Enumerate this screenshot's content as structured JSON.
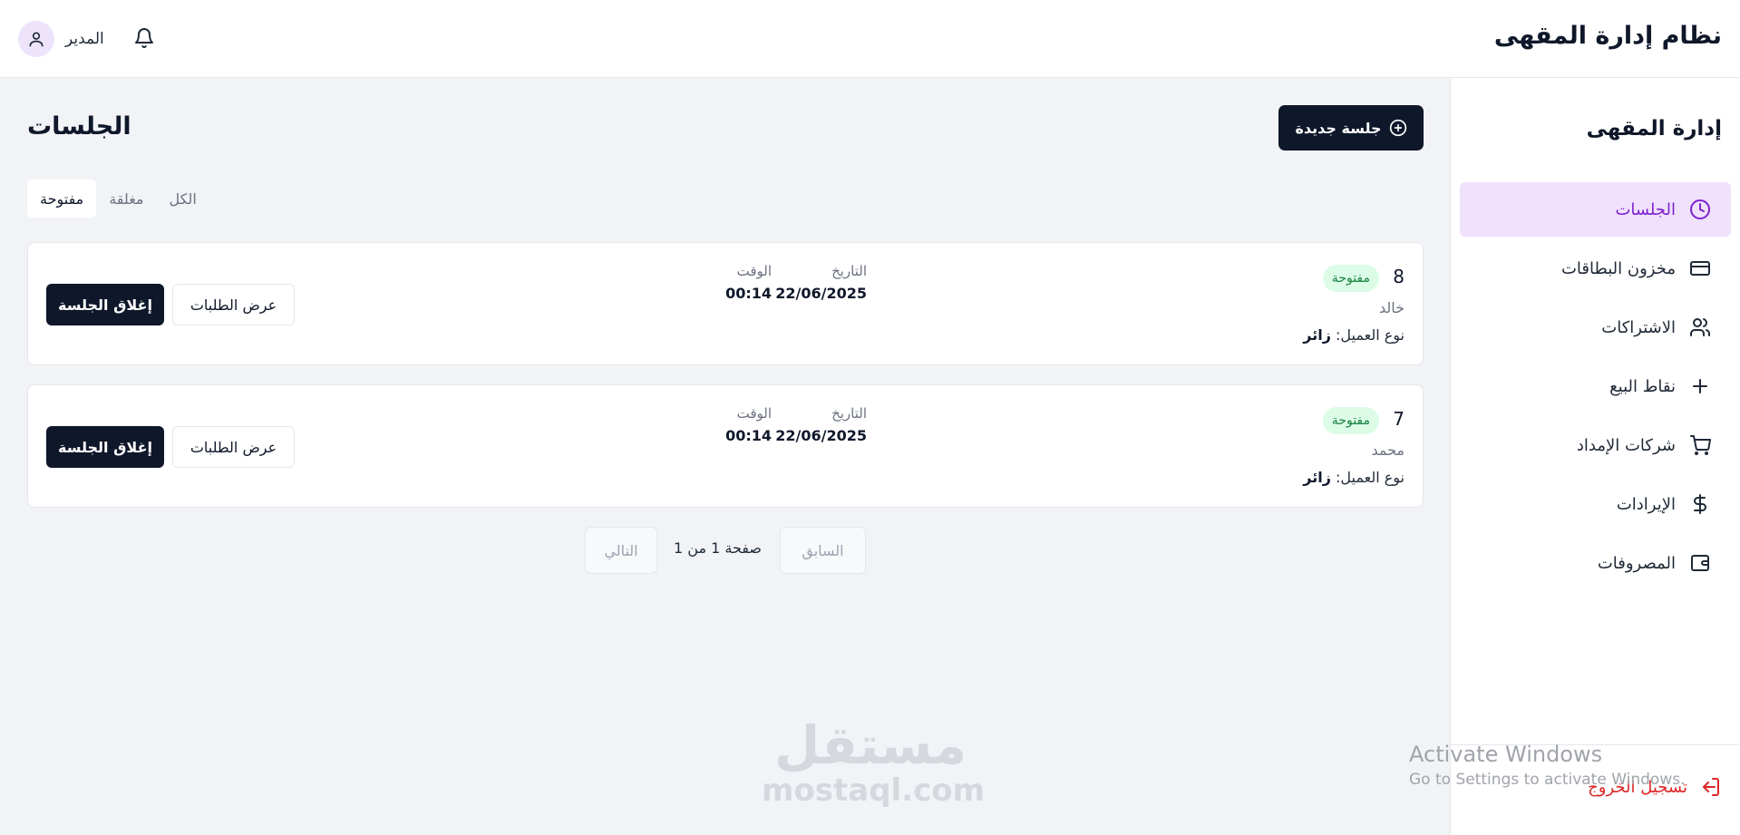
{
  "header": {
    "app_title": "نظام إدارة المقهى",
    "user_name": "المدير",
    "avatar_icon": "user-icon",
    "notification_icon": "bell-icon"
  },
  "sidebar": {
    "title": "إدارة المقهى",
    "items": [
      {
        "label": "الجلسات",
        "icon": "clock-icon",
        "active": true
      },
      {
        "label": "مخزون البطاقات",
        "icon": "card-icon",
        "active": false
      },
      {
        "label": "الاشتراكات",
        "icon": "users-icon",
        "active": false
      },
      {
        "label": "نقاط البيع",
        "icon": "plus-icon",
        "active": false
      },
      {
        "label": "شركات الإمداد",
        "icon": "cart-icon",
        "active": false
      },
      {
        "label": "الإيرادات",
        "icon": "dollar-icon",
        "active": false
      },
      {
        "label": "المصروفات",
        "icon": "wallet-icon",
        "active": false
      }
    ],
    "logout_label": "تسجيل الخروج"
  },
  "main": {
    "page_title": "الجلسات",
    "new_session_label": "جلسة جديدة",
    "tabs": [
      {
        "label": "مفتوحة",
        "active": true
      },
      {
        "label": "مغلقة",
        "active": false
      },
      {
        "label": "الكل",
        "active": false
      }
    ],
    "date_label": "التاريخ",
    "time_label": "الوقت",
    "client_type_label": "نوع العميل:",
    "view_orders_label": "عرض الطلبات",
    "close_session_label": "إغلاق الجلسة",
    "sessions": [
      {
        "id": "8",
        "status": "مفتوحة",
        "client": "خالد",
        "client_type": "زائر",
        "date": "22/06/2025",
        "time": "00:14"
      },
      {
        "id": "7",
        "status": "مفتوحة",
        "client": "محمد",
        "client_type": "زائر",
        "date": "22/06/2025",
        "time": "00:14"
      }
    ],
    "pagination": {
      "prev_label": "السابق",
      "next_label": "التالي",
      "page_text": "صفحة 1 من 1"
    }
  },
  "watermark": {
    "arabic": "مستقل",
    "latin": "mostaql.com"
  },
  "os_overlay": {
    "line1": "Activate Windows",
    "line2": "Go to Settings to activate Windows."
  },
  "colors": {
    "primary": "#0f172a",
    "accent": "#7e22ce",
    "active_bg": "#f0e1fd",
    "status_bg": "#dcfce7",
    "status_fg": "#15803d",
    "danger": "#dc2626"
  }
}
